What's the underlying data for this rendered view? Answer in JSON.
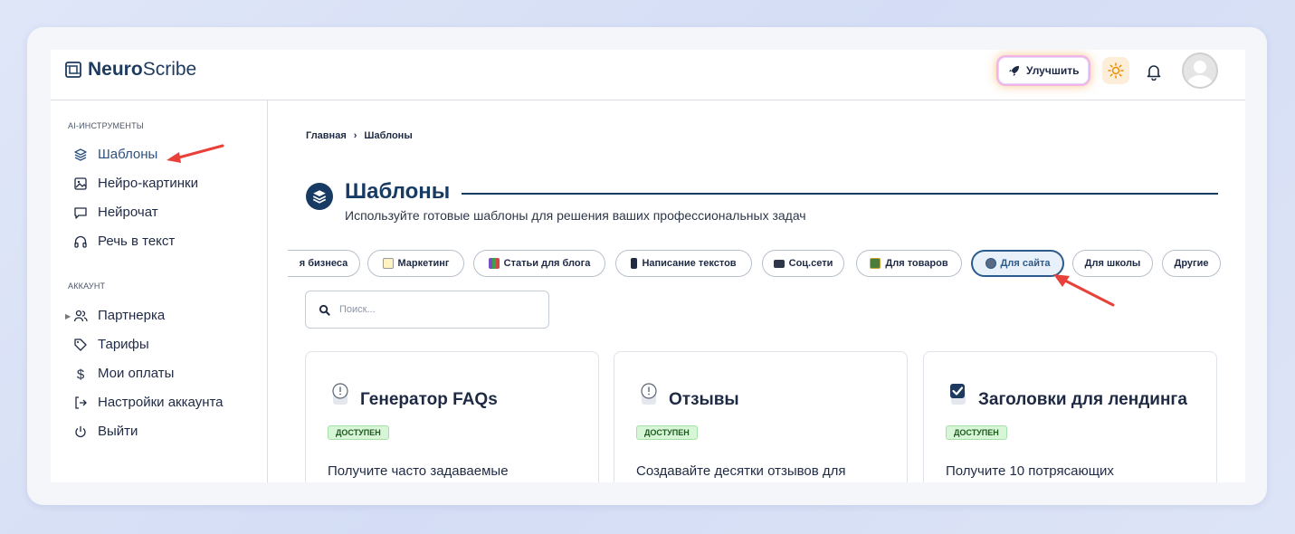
{
  "brand": {
    "name_bold": "Neuro",
    "name_rest": "Scribe"
  },
  "header": {
    "upgrade_label": "Улучшить"
  },
  "sidebar": {
    "section_ai": "AI-ИНСТРУМЕНТЫ",
    "ai_items": [
      {
        "label": "Шаблоны",
        "icon": "layers-icon"
      },
      {
        "label": "Нейро-картинки",
        "icon": "image-icon"
      },
      {
        "label": "Нейрочат",
        "icon": "chat-icon"
      },
      {
        "label": "Речь в текст",
        "icon": "headphones-icon"
      }
    ],
    "section_account": "АККАУНТ",
    "account_items": [
      {
        "label": "Партнерка",
        "icon": "users-icon"
      },
      {
        "label": "Тарифы",
        "icon": "tag-icon"
      },
      {
        "label": "Мои оплаты",
        "icon": "dollar-icon"
      },
      {
        "label": "Настройки аккаунта",
        "icon": "login-icon"
      },
      {
        "label": "Выйти",
        "icon": "power-icon"
      }
    ]
  },
  "breadcrumb": {
    "home": "Главная",
    "current": "Шаблоны"
  },
  "page": {
    "title": "Шаблоны",
    "subtitle": "Используйте готовые шаблоны для решения ваших профессиональных задач"
  },
  "categories": [
    {
      "label": "я бизнеса"
    },
    {
      "label": "Маркетинг"
    },
    {
      "label": "Статьи для блога"
    },
    {
      "label": "Написание текстов"
    },
    {
      "label": "Соц.сети"
    },
    {
      "label": "Для товаров"
    },
    {
      "label": "Для сайта",
      "active": true
    },
    {
      "label": "Для школы"
    },
    {
      "label": "Другие"
    }
  ],
  "search": {
    "placeholder": "Поиск..."
  },
  "cards": [
    {
      "title": "Генератор FAQs",
      "badge": "ДОСТУПЕН",
      "desc": "Получите часто задаваемые",
      "icon": "info-icon"
    },
    {
      "title": "Отзывы",
      "badge": "ДОСТУПЕН",
      "desc": "Создавайте десятки отзывов для",
      "icon": "info-icon"
    },
    {
      "title": "Заголовки для лендинга",
      "badge": "ДОСТУПЕН",
      "desc": "Получите 10 потрясающих",
      "icon": "checkbox-icon"
    }
  ],
  "colors": {
    "accent": "#173b63",
    "annotation": "#e8413a",
    "badge_bg": "#d7f5d7"
  }
}
